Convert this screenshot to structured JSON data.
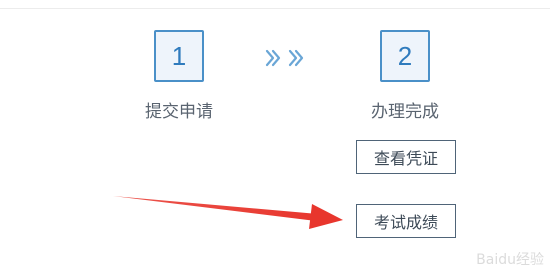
{
  "steps": [
    {
      "number": "1",
      "label": "提交申请"
    },
    {
      "number": "2",
      "label": "办理完成"
    }
  ],
  "actions": {
    "view_certificate": "查看凭证",
    "exam_results": "考试成绩"
  },
  "annotation": {
    "arrow_color": "#e8362d"
  },
  "colors": {
    "accent": "#4a90c8",
    "step_bg": "#eef4fb"
  },
  "watermark": {
    "text": "Baidu经验"
  }
}
